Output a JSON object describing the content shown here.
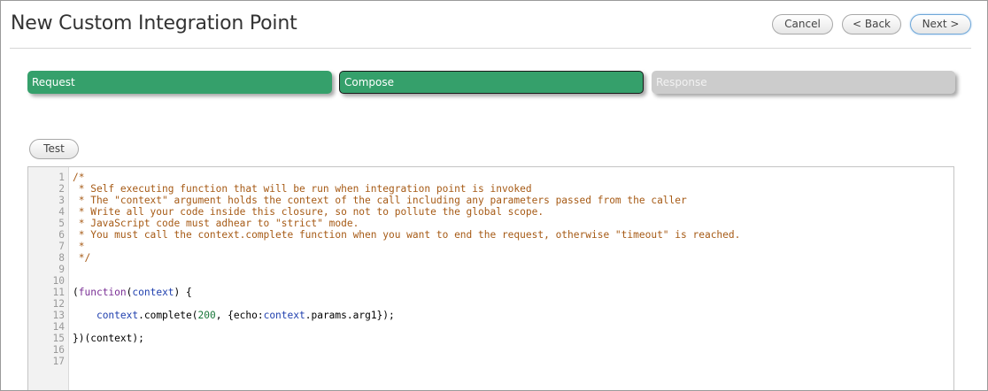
{
  "page": {
    "title": "New Custom Integration Point"
  },
  "header": {
    "cancel_label": "Cancel",
    "back_label": "< Back",
    "next_label": "Next >"
  },
  "steps": [
    {
      "label": "Request",
      "state": "done"
    },
    {
      "label": "Compose",
      "state": "active"
    },
    {
      "label": "Response",
      "state": "pending"
    }
  ],
  "toolbar": {
    "test_label": "Test"
  },
  "colors": {
    "step_active": "#35a06b",
    "step_pending": "#cccccc",
    "comment": "#a65a15",
    "keyword": "#7a2f95",
    "variable": "#1f3fae",
    "number": "#19773a"
  },
  "editor": {
    "lines": [
      {
        "n": "1",
        "segments": [
          {
            "t": "/*",
            "c": "comment"
          }
        ]
      },
      {
        "n": "2",
        "segments": [
          {
            "t": " * Self executing function that will be run when integration point is invoked",
            "c": "comment"
          }
        ]
      },
      {
        "n": "3",
        "segments": [
          {
            "t": " * The \"context\" argument holds the context of the call including any parameters passed from the caller",
            "c": "comment"
          }
        ]
      },
      {
        "n": "4",
        "segments": [
          {
            "t": " * Write all your code inside this closure, so not to pollute the global scope.",
            "c": "comment"
          }
        ]
      },
      {
        "n": "5",
        "segments": [
          {
            "t": " * JavaScript code must adhear to \"strict\" mode.",
            "c": "comment"
          }
        ]
      },
      {
        "n": "6",
        "segments": [
          {
            "t": " * You must call the context.complete function when you want to end the request, otherwise \"timeout\" is reached.",
            "c": "comment"
          }
        ]
      },
      {
        "n": "7",
        "segments": [
          {
            "t": " *",
            "c": "comment"
          }
        ]
      },
      {
        "n": "8",
        "segments": [
          {
            "t": " */",
            "c": "comment"
          }
        ]
      },
      {
        "n": "9",
        "segments": []
      },
      {
        "n": "10",
        "segments": []
      },
      {
        "n": "11",
        "segments": [
          {
            "t": "(",
            "c": "plain"
          },
          {
            "t": "function",
            "c": "keyword"
          },
          {
            "t": "(",
            "c": "plain"
          },
          {
            "t": "context",
            "c": "var"
          },
          {
            "t": ") {",
            "c": "plain"
          }
        ]
      },
      {
        "n": "12",
        "segments": []
      },
      {
        "n": "13",
        "segments": [
          {
            "t": "    ",
            "c": "plain"
          },
          {
            "t": "context",
            "c": "var"
          },
          {
            "t": ".complete(",
            "c": "plain"
          },
          {
            "t": "200",
            "c": "num"
          },
          {
            "t": ", {echo:",
            "c": "plain"
          },
          {
            "t": "context",
            "c": "var"
          },
          {
            "t": ".params.arg1});",
            "c": "plain"
          }
        ]
      },
      {
        "n": "14",
        "segments": []
      },
      {
        "n": "15",
        "segments": [
          {
            "t": "})(context);",
            "c": "plain"
          }
        ]
      },
      {
        "n": "16",
        "segments": []
      },
      {
        "n": "17",
        "segments": []
      }
    ]
  }
}
